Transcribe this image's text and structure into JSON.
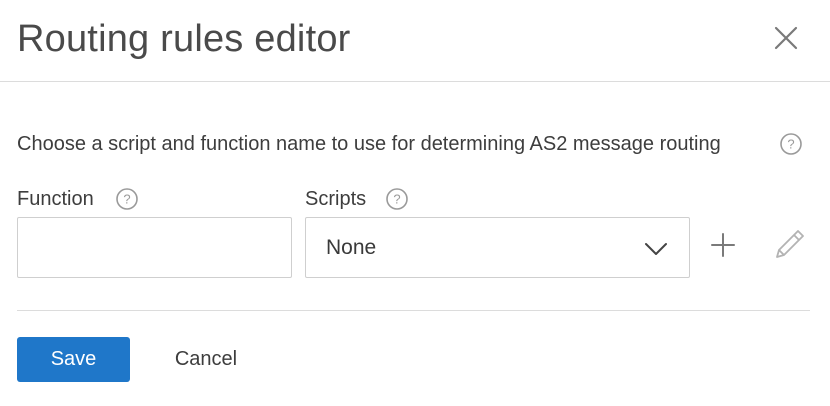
{
  "dialog": {
    "title": "Routing rules editor",
    "close_icon": "close-icon"
  },
  "description": {
    "text": "Choose a script and function name to use for determining AS2 message routing",
    "help_icon": "help-circle-icon"
  },
  "function_field": {
    "label": "Function",
    "value": "",
    "placeholder": "",
    "help_icon": "help-circle-icon"
  },
  "scripts_field": {
    "label": "Scripts",
    "selected": "None",
    "help_icon": "help-circle-icon",
    "dropdown_icon": "chevron-down-icon",
    "add_icon": "plus-icon",
    "edit_icon": "pencil-icon"
  },
  "actions": {
    "save_label": "Save",
    "cancel_label": "Cancel"
  },
  "colors": {
    "primary": "#1f77c9",
    "border": "#cfcfcf",
    "icon_gray": "#9a9a9a"
  }
}
